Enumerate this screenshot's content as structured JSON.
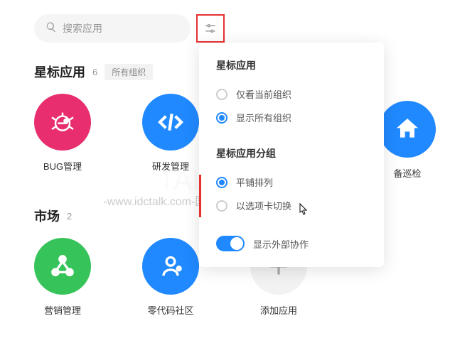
{
  "search": {
    "placeholder": "搜索应用"
  },
  "sections": {
    "starred": {
      "title": "星标应用",
      "count": "6",
      "org_tag": "所有组织"
    },
    "market": {
      "title": "市场",
      "count": "2"
    }
  },
  "apps": {
    "bug": {
      "label": "BUG管理",
      "color": "#e82e6e"
    },
    "dev": {
      "label": "研发管理",
      "color": "#2089ff"
    },
    "inspect": {
      "label": "备巡检",
      "color": "#2089ff"
    },
    "marketing": {
      "label": "营销管理",
      "color": "#36c45a"
    },
    "zerocode": {
      "label": "零代码社区",
      "color": "#2089ff"
    },
    "add": {
      "label": "添加应用"
    }
  },
  "popover": {
    "title1": "星标应用",
    "opt1": "仅看当前组织",
    "opt2": "显示所有组织",
    "title2": "星标应用分组",
    "opt3": "平铺排列",
    "opt4": "以选项卡切换",
    "switch_label": "显示外部协作"
  },
  "watermark": {
    "big": "TALK 云说",
    "small": "-www.idctalk.com-国内专业云计算交流服务平台-"
  }
}
